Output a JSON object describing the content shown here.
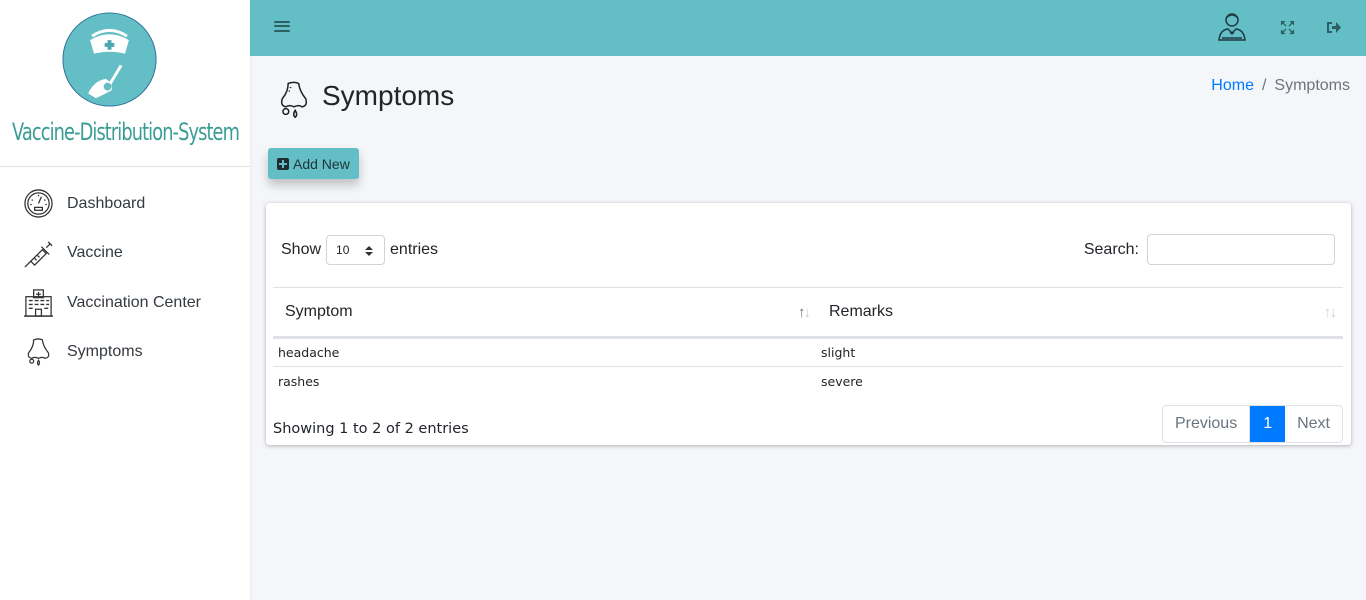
{
  "brand": {
    "name": "Vaccine-Distribution-System"
  },
  "sidebar": {
    "items": [
      {
        "label": "Dashboard",
        "icon": "speedometer-icon"
      },
      {
        "label": "Vaccine",
        "icon": "syringe-icon"
      },
      {
        "label": "Vaccination Center",
        "icon": "hospital-icon"
      },
      {
        "label": "Symptoms",
        "icon": "nose-icon"
      }
    ]
  },
  "topbar": {
    "menu_icon": "hamburger-icon",
    "user_icon": "doctor-avatar-icon",
    "fullscreen_icon": "expand-icon",
    "logout_icon": "sign-out-icon",
    "color": "#63bec5"
  },
  "page": {
    "title": "Symptoms",
    "icon": "nose-icon",
    "breadcrumb": {
      "home": "Home",
      "separator": "/",
      "current": "Symptoms"
    },
    "add_button": "Add New"
  },
  "table_controls": {
    "show_label": "Show",
    "length_value": "10",
    "entries_label": "entries",
    "search_label": "Search:",
    "search_value": ""
  },
  "table": {
    "columns": [
      "Symptom",
      "Remarks"
    ],
    "rows": [
      [
        "headache",
        "slight"
      ],
      [
        "rashes",
        "severe"
      ]
    ]
  },
  "footer": {
    "info": "Showing 1 to 2 of 2 entries",
    "prev": "Previous",
    "current_page": "1",
    "next": "Next",
    "active_color": "#007bff"
  }
}
